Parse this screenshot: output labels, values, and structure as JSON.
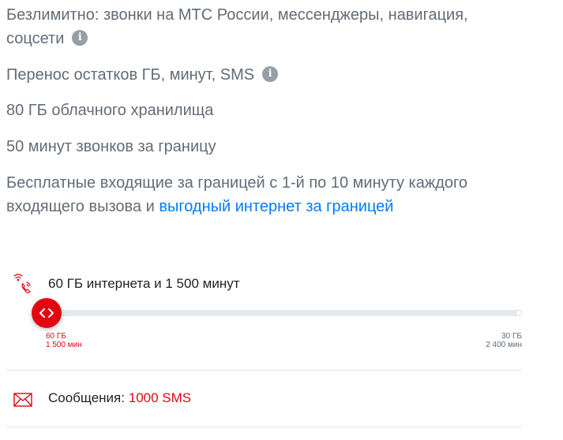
{
  "features": [
    {
      "text_line1": "Безлимитно: звонки на МТС России, мессенджеры, навигация,",
      "text_line2": "соцсети",
      "info": "i"
    },
    {
      "text": "Перенос остатков ГБ, минут, SMS",
      "info": "i"
    },
    {
      "text": "80 ГБ облачного хранилища"
    },
    {
      "text": "50 минут звонков за границу"
    },
    {
      "text_line1": "Бесплатные входящие за границей с 1-й по 10 минуту каждого",
      "text_line2_prefix": "входящего вызова и",
      "link": "выгодный интернет за границей"
    }
  ],
  "bundle": {
    "icon": "wifi-phone-icon",
    "label": "60 ГБ интернета и 1 500 минут",
    "slider_level": 0,
    "min_gb": "60 ГБ",
    "min_minutes": "1 500 мин",
    "max_gb": "30 ГБ",
    "max_minutes": "2 400 мин"
  },
  "sms": {
    "icon": "envelope-icon",
    "label": "Сообщения:",
    "value": "1000 SMS"
  },
  "colors": {
    "accent": "#e30611",
    "link": "#007cff",
    "text": "#626c77",
    "info_icon": "#969fa8"
  }
}
